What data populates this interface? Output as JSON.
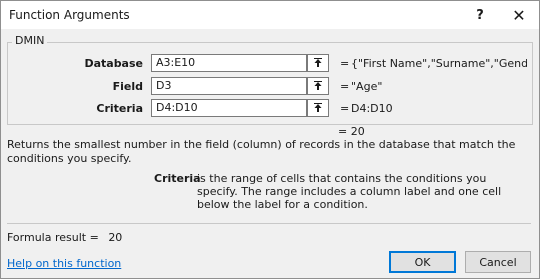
{
  "window": {
    "title": "Function Arguments",
    "help_glyph": "?",
    "close_glyph": "✕"
  },
  "function": {
    "name": "DMIN",
    "arguments": [
      {
        "label": "Database",
        "input": "A3:E10",
        "value": "{\"First Name\",\"Surname\",\"Gender\",\"..."
      },
      {
        "label": "Field",
        "input": "D3",
        "value": "\"Age\""
      },
      {
        "label": "Criteria",
        "input": "D4:D10",
        "value": "D4:D10"
      }
    ],
    "result": "20",
    "description": "Returns the smallest number in the field (column) of records in the database that match the conditions you specify.",
    "param_name": "Criteria",
    "param_description": "is the range of cells that contains the conditions you specify. The range includes a column label and one cell below the label for a condition."
  },
  "footer": {
    "formula_result_label": "Formula result =",
    "formula_result_value": "20",
    "help_link": "Help on this function",
    "ok_label": "OK",
    "cancel_label": "Cancel"
  },
  "colors": {
    "link": "#0066cc",
    "ok_border": "#0078d7"
  },
  "icons": {
    "collapse": "collapse-dialog-icon",
    "help": "help-icon",
    "close": "close-icon"
  }
}
